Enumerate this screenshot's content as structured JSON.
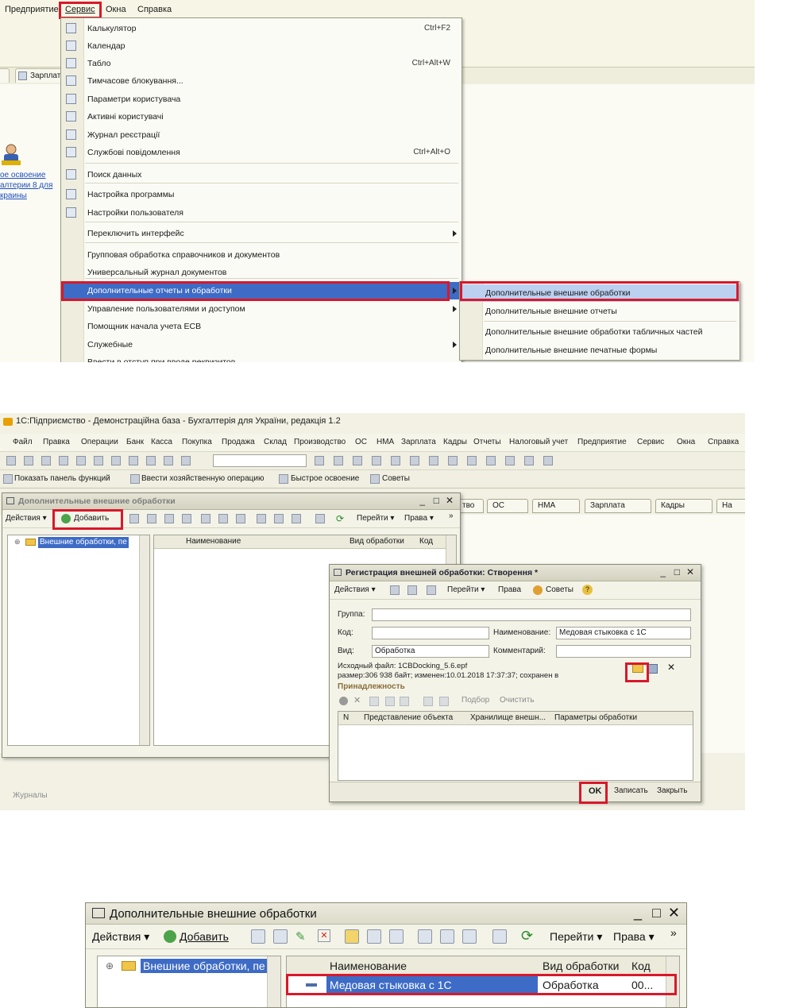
{
  "colors": {
    "highlight_frame": "#d9182a",
    "selection": "#3d6bc5",
    "window_bg": "#f4f3e8"
  },
  "shot1": {
    "menubar": [
      "Предприятие",
      "Сервис",
      "Окна",
      "Справка"
    ],
    "tabs": [
      "Зарплата"
    ],
    "left_link": [
      "ое освоение",
      "алтерии 8 для",
      "краины"
    ],
    "menu": [
      {
        "label": "Калькулятор",
        "shortcut": "Ctrl+F2",
        "icon": "calculator-icon"
      },
      {
        "label": "Календар",
        "shortcut": "",
        "icon": "calendar-icon"
      },
      {
        "label": "Табло",
        "shortcut": "Ctrl+Alt+W",
        "icon": "board-icon"
      },
      {
        "label": "Тимчасове блокування...",
        "shortcut": "",
        "icon": "lock-users-icon"
      },
      {
        "label": "Параметри користувача",
        "shortcut": "",
        "icon": "user-params-icon"
      },
      {
        "label": "Активні користувачі",
        "shortcut": "",
        "icon": "active-users-icon"
      },
      {
        "label": "Журнал реєстрації",
        "shortcut": "",
        "icon": "log-icon"
      },
      {
        "label": "Службові повідомлення",
        "shortcut": "Ctrl+Alt+O",
        "icon": "messages-icon"
      },
      {
        "label": "Поиск данных",
        "shortcut": "",
        "icon": "search-icon"
      },
      {
        "label": "Настройка программы",
        "shortcut": "",
        "icon": "settings-icon"
      },
      {
        "label": "Настройки пользователя",
        "shortcut": "",
        "icon": "user-icon"
      },
      {
        "label": "Переключить интерфейс",
        "shortcut": "",
        "icon": ""
      },
      {
        "label": "Групповая обработка справочников и документов",
        "shortcut": "",
        "icon": ""
      },
      {
        "label": "Универсальный журнал документов",
        "shortcut": "",
        "icon": ""
      },
      {
        "label": "Дополнительные отчеты и обработки",
        "shortcut": "",
        "icon": ""
      },
      {
        "label": "Управление пользователями и доступом",
        "shortcut": "",
        "icon": ""
      },
      {
        "label": "Помощник начала учета ЕСВ",
        "shortcut": "",
        "icon": ""
      },
      {
        "label": "Служебные",
        "shortcut": "",
        "icon": ""
      },
      {
        "label": "Ввести в отступ при вводе реквизитов",
        "shortcut": "",
        "icon": ""
      }
    ],
    "submenu": [
      "Дополнительные внешние обработки",
      "Дополнительные внешние отчеты",
      "Дополнительные внешние обработки табличных частей",
      "Дополнительные внешние печатные формы"
    ]
  },
  "shot2": {
    "title": "1С:Підприємство - Демонстраційна база - Бухгалтерія для України, редакція 1.2",
    "menubar": [
      "Файл",
      "Правка",
      "Операции",
      "Банк",
      "Касса",
      "Покупка",
      "Продажа",
      "Склад",
      "Производство",
      "ОС",
      "НМА",
      "Зарплата",
      "Кадры",
      "Отчеты",
      "Налоговый учет",
      "Предприятие",
      "Сервис",
      "Окна",
      "Справка"
    ],
    "toolbar2": [
      "Показать панель функций",
      "Ввести хозяйственную операцию",
      "Быстрое освоение",
      "Советы"
    ],
    "right_tabs": [
      "тво",
      "ОС",
      "НМА",
      "Зарплата",
      "Кадры",
      "На"
    ],
    "list_window": {
      "title": "Дополнительные внешние обработки",
      "actions": "Действия",
      "add": "Добавить",
      "goto": "Перейти",
      "rights": "Права",
      "tree_item": "Внешние обработки, пе",
      "columns": [
        "Наименование",
        "Вид обработки",
        "Код"
      ]
    },
    "reg_window": {
      "title": "Регистрация внешней обработки: Створення *",
      "actions": "Действия",
      "goto": "Перейти",
      "rights": "Права",
      "tips": "Советы",
      "group_label": "Группа:",
      "code_label": "Код:",
      "name_label": "Наименование:",
      "name_value": "Медовая стыковка с 1С",
      "kind_label": "Вид:",
      "kind_value": "Обработка",
      "comment_label": "Комментарий:",
      "source_file": "Исходный файл: 1CBDocking_5.6.epf",
      "size_info": "размер:306 938 байт; изменен:10.01.2018 17:37:37; сохранен в",
      "belonging": "Принадлежность",
      "pick": "Подбор",
      "clear": "Очистить",
      "columns": [
        "N",
        "Представление объекта",
        "Хранилище внешн...",
        "Параметры обработки"
      ],
      "ok": "OK",
      "write": "Записать",
      "close": "Закрыть"
    },
    "journals": "Журналы"
  },
  "shot3": {
    "title": "Дополнительные внешние обработки",
    "actions": "Действия",
    "add": "Добавить",
    "goto": "Перейти",
    "rights": "Права",
    "tree_item": "Внешние обработки, пе",
    "columns": [
      "Наименование",
      "Вид обработки",
      "Код"
    ],
    "row": {
      "name": "Медовая стыковка с 1С",
      "kind": "Обработка",
      "code": "00..."
    }
  }
}
